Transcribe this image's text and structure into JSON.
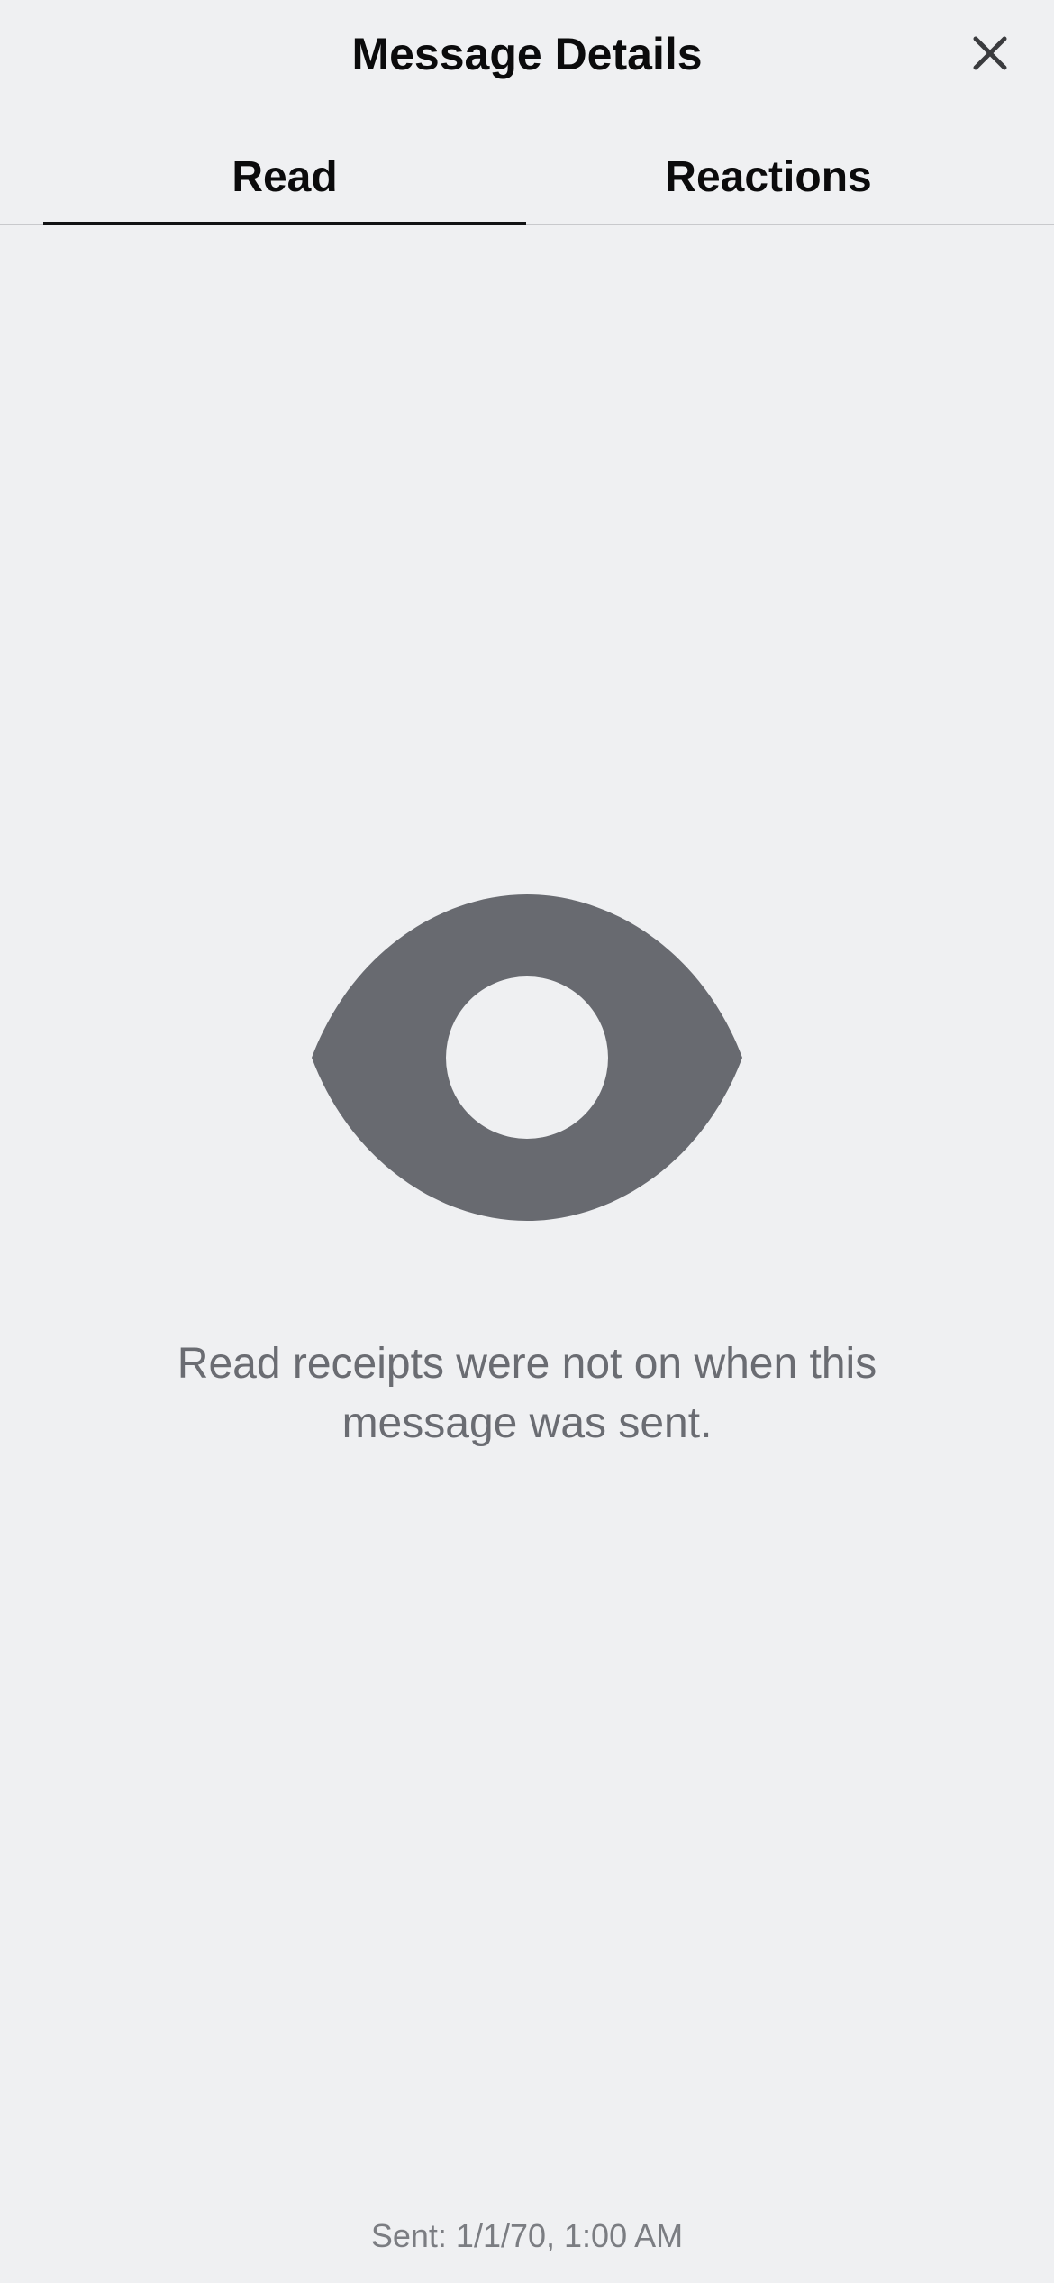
{
  "header": {
    "title": "Message Details",
    "close_icon": "close-icon"
  },
  "tabs": [
    {
      "label": "Read",
      "selected": true
    },
    {
      "label": "Reactions",
      "selected": false
    }
  ],
  "empty_state": {
    "icon": "eye-icon",
    "message": "Read receipts were not on when this message was sent."
  },
  "footer": {
    "sent": "Sent: 1/1/70, 1:00 AM"
  },
  "colors": {
    "background": "#eff0f2",
    "icon_gray": "#686a70",
    "text_secondary": "#6a6c72",
    "tab_indicator": "#111214"
  }
}
